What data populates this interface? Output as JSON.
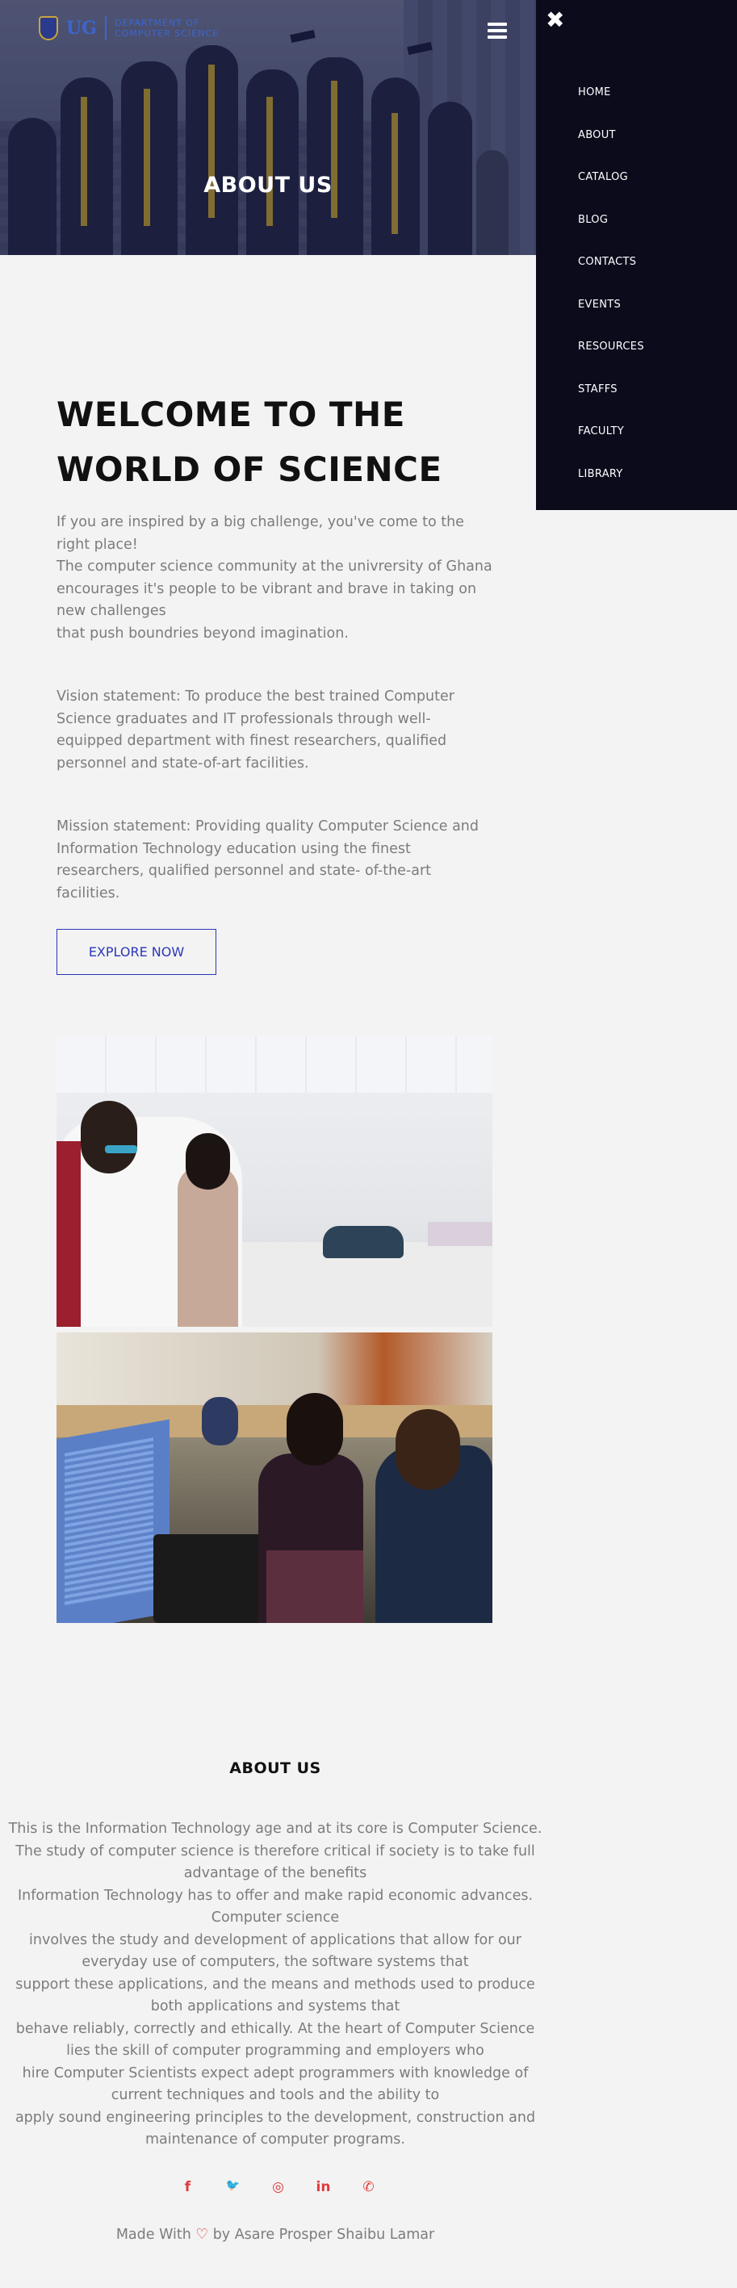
{
  "brand": {
    "logo_text": "UG",
    "dept_line1": "DEPARTMENT OF",
    "dept_line2": "COMPUTER SCIENCE"
  },
  "hero": {
    "title": "ABOUT US"
  },
  "menu": {
    "close_icon": "close-icon",
    "items": [
      "HOME",
      "ABOUT",
      "CATALOG",
      "BLOG",
      "CONTACTS",
      "EVENTS",
      "RESOURCES",
      "STAFFS",
      "FACULTY",
      "LIBRARY"
    ]
  },
  "welcome": {
    "title_line1": "WELCOME TO THE",
    "title_line2": "WORLD OF SCIENCE",
    "intro_line1": "If you are inspired by a big challenge, you've come to the right place!",
    "intro_line2": "The computer science community at the univrersity of Ghana encourages it's people to be vibrant and brave in taking on new challenges",
    "intro_line3": "that push boundries beyond imagination.",
    "vision": "Vision statement: To produce the best trained Computer Science graduates and IT professionals through well-equipped department with finest researchers, qualified personnel and state-of-art facilities.",
    "mission": "Mission statement: Providing quality Computer Science and Information Technology education using the finest researchers, qualified personnel and state- of-the-art facilities.",
    "explore_button": "EXPLORE NOW"
  },
  "about": {
    "heading": "ABOUT US",
    "line1": "This is the Information Technology age and at its core is Computer Science.",
    "line2": "The study of computer science is therefore critical if society is to take full advantage of the benefits",
    "line3": "Information Technology has to offer and make rapid economic advances. Computer science",
    "line4": "involves the study and development of applications that allow for our everyday use of computers, the software systems that",
    "line5": "support these applications, and the means and methods used to produce both applications and systems that",
    "line6": "behave reliably, correctly and ethically. At the heart of Computer Science lies the skill of computer programming and employers who",
    "line7": "hire Computer Scientists expect adept programmers with knowledge of current techniques and tools and the ability to",
    "line8": "apply sound engineering principles to the development, construction and maintenance of computer programs."
  },
  "social": {
    "facebook": "f",
    "twitter": "🐦",
    "instagram": "◎",
    "linkedin": "in",
    "whatsapp": "✆"
  },
  "footer": {
    "made_with": "Made With",
    "heart": "♡",
    "by": "by Asare Prosper Shaibu Lamar"
  },
  "colors": {
    "menu_bg": "#0b0b1c",
    "accent_blue": "#2b37b8",
    "social_red": "#e03a3a"
  }
}
